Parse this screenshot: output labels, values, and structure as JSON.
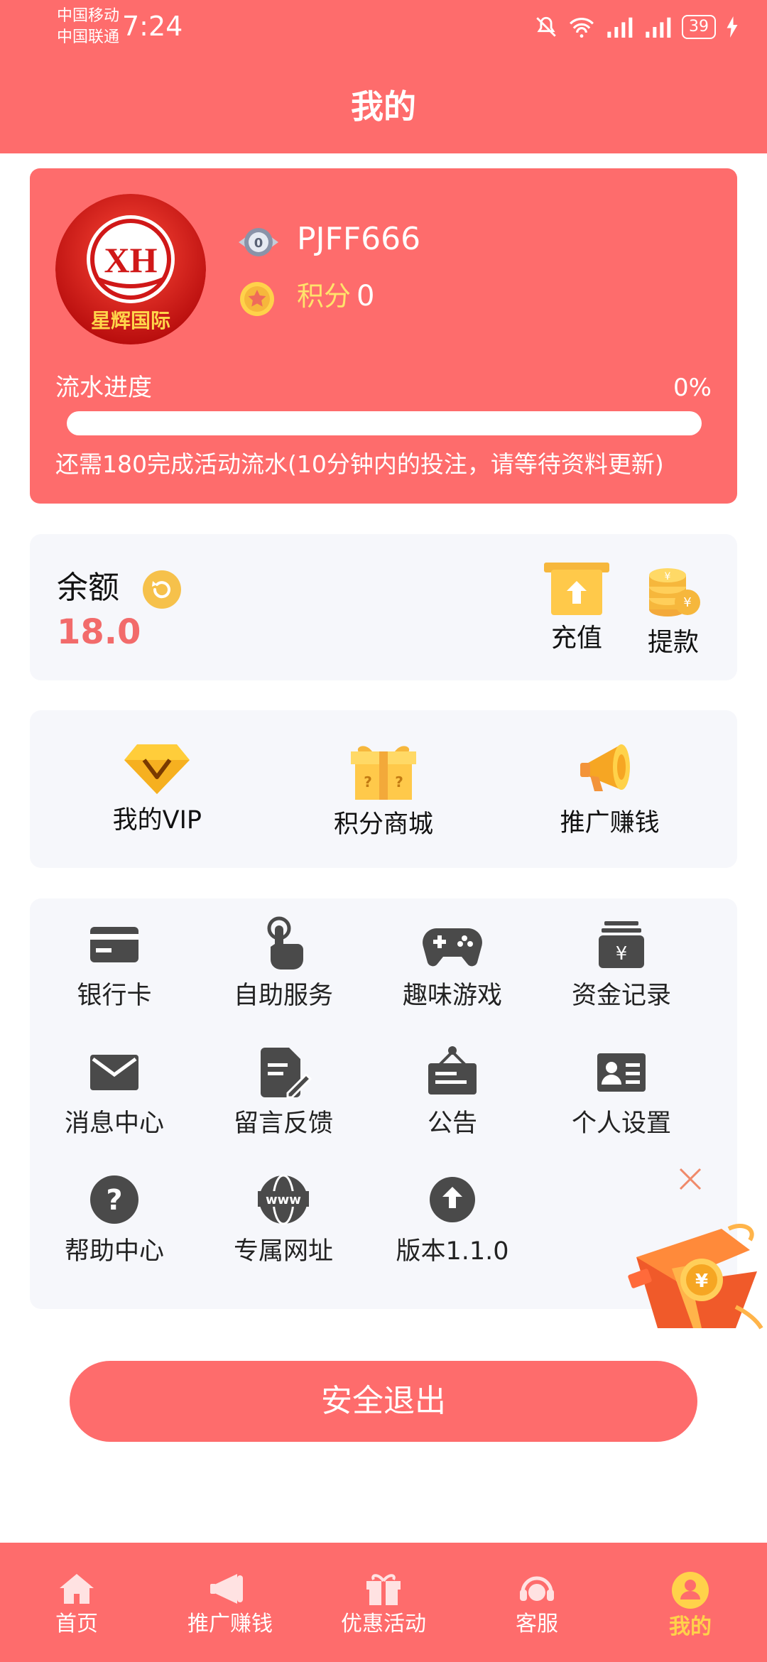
{
  "status_bar": {
    "carrier_1": "中国移动",
    "carrier_2": "中国联通",
    "time": "7:24",
    "battery": "39"
  },
  "header": {
    "title": "我的"
  },
  "profile": {
    "username": "PJFF666",
    "level": "0",
    "points_label": "积分",
    "points_value": "0",
    "avatar_text": "XH",
    "avatar_caption": "星辉国际",
    "progress_label": "流水进度",
    "progress_percent": "0%",
    "progress_fraction": 0,
    "progress_note": "还需180完成活动流水(10分钟内的投注，请等待资料更新)"
  },
  "balance": {
    "label": "余额",
    "value": "18.0",
    "recharge_label": "充值",
    "withdraw_label": "提款"
  },
  "features": [
    {
      "label": "我的VIP",
      "icon": "vip-diamond-icon"
    },
    {
      "label": "积分商城",
      "icon": "gift-box-icon"
    },
    {
      "label": "推广赚钱",
      "icon": "megaphone-icon"
    }
  ],
  "menu": [
    {
      "label": "银行卡",
      "icon": "bank-card-icon"
    },
    {
      "label": "自助服务",
      "icon": "hand-pointer-icon"
    },
    {
      "label": "趣味游戏",
      "icon": "gamepad-icon"
    },
    {
      "label": "资金记录",
      "icon": "fund-record-icon"
    },
    {
      "label": "消息中心",
      "icon": "envelope-icon"
    },
    {
      "label": "留言反馈",
      "icon": "feedback-document-icon"
    },
    {
      "label": "公告",
      "icon": "notice-board-icon"
    },
    {
      "label": "个人设置",
      "icon": "id-card-icon"
    },
    {
      "label": "帮助中心",
      "icon": "question-icon"
    },
    {
      "label": "专属网址",
      "icon": "www-globe-icon"
    },
    {
      "label": "版本1.1.0",
      "icon": "upload-arrow-icon"
    }
  ],
  "logout_label": "安全退出",
  "tabs": [
    {
      "label": "首页",
      "icon": "home-icon"
    },
    {
      "label": "推广赚钱",
      "icon": "megaphone-icon"
    },
    {
      "label": "优惠活动",
      "icon": "gift-icon"
    },
    {
      "label": "客服",
      "icon": "headset-icon"
    },
    {
      "label": "我的",
      "icon": "user-icon",
      "active": true
    }
  ],
  "colors": {
    "brand": "#fe6c6c",
    "points_text": "#ffe36b",
    "balance_value": "#f26b6b",
    "active_tab": "#ffd24a",
    "panel_bg": "#f6f7fb",
    "icon_gray": "#4a4a4a"
  }
}
